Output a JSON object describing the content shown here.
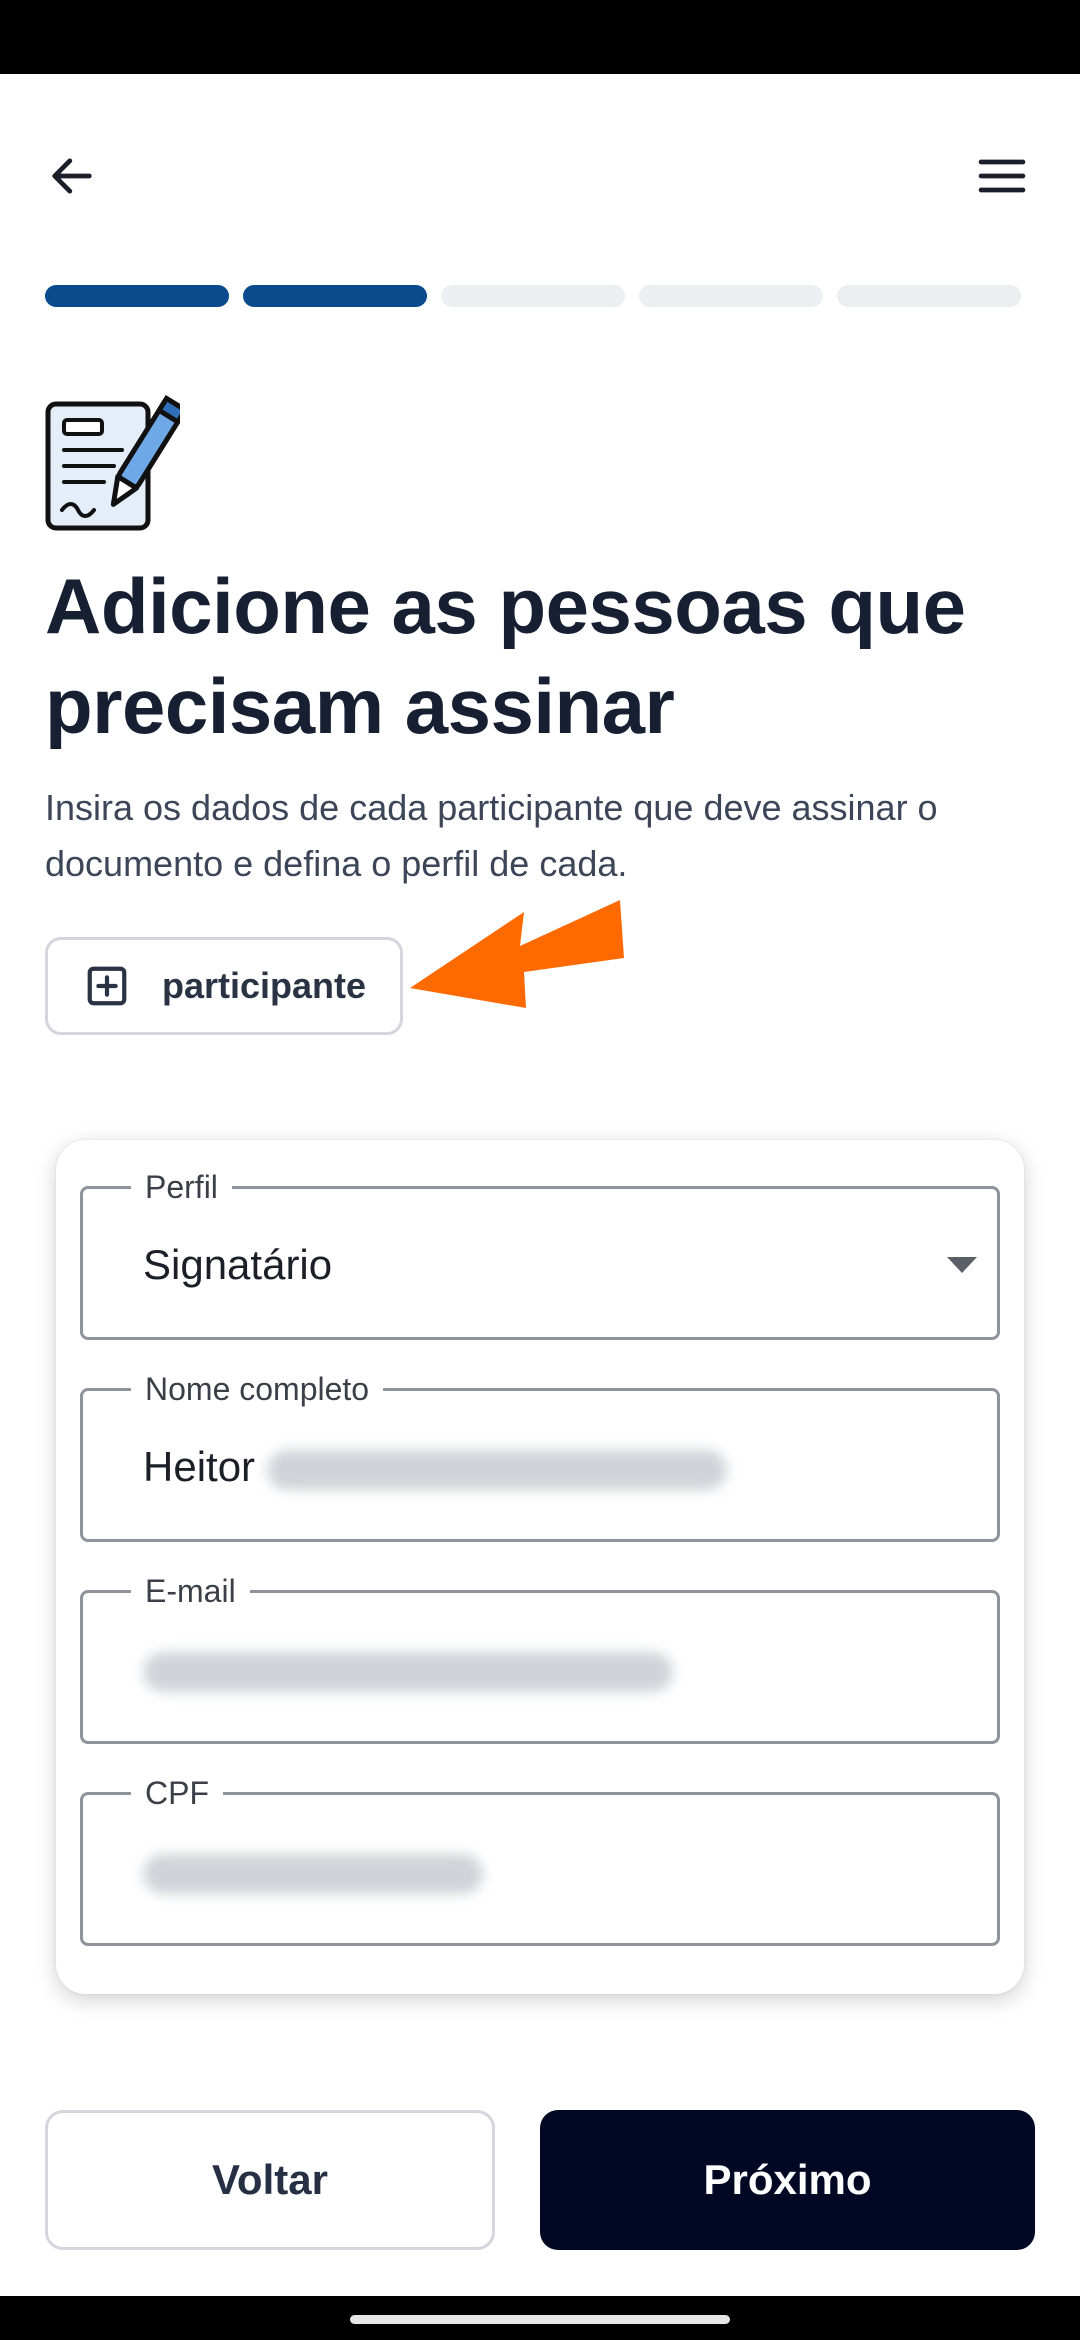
{
  "header": {
    "back_icon": "arrow-left-icon",
    "menu_icon": "hamburger-menu-icon"
  },
  "progress": {
    "total_steps": 5,
    "current_step": 2
  },
  "page": {
    "icon": "document-signature-icon",
    "title": "Adicione as pessoas que precisam assinar",
    "subtitle": "Insira os dados de cada participante que deve assinar o documento e defina o perfil de cada.",
    "add_button_label": "participante",
    "add_button_icon": "plus-square-icon"
  },
  "form": {
    "profile": {
      "label": "Perfil",
      "value": "Signatário"
    },
    "full_name": {
      "label": "Nome completo",
      "value": "Heitor"
    },
    "email": {
      "label": "E-mail"
    },
    "cpf": {
      "label": "CPF"
    }
  },
  "footer": {
    "back_label": "Voltar",
    "next_label": "Próximo"
  },
  "colors": {
    "progress_active": "#0b4a8b",
    "progress_inactive": "#eceef2",
    "primary_button": "#020824",
    "annotation_arrow": "#ff6a00"
  }
}
